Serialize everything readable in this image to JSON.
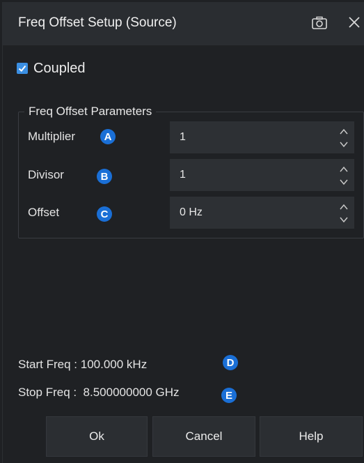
{
  "dialog": {
    "title": "Freq Offset Setup (Source)"
  },
  "coupled": {
    "label": "Coupled",
    "checked": true
  },
  "group": {
    "title": "Freq Offset Parameters",
    "params": [
      {
        "label": "Multiplier",
        "badge": "A",
        "value": "1"
      },
      {
        "label": "Divisor",
        "badge": "B",
        "value": "1"
      },
      {
        "label": "Offset",
        "badge": "C",
        "value": "0 Hz"
      }
    ]
  },
  "info": {
    "start": {
      "text": "Start Freq : 100.000 kHz",
      "badge": "D"
    },
    "stop": {
      "text": "Stop Freq :  8.500000000 GHz",
      "badge": "E"
    }
  },
  "buttons": {
    "ok": "Ok",
    "cancel": "Cancel",
    "help": "Help"
  },
  "colors": {
    "accent": "#3b8fe3",
    "badge": "#1a6fd6"
  }
}
